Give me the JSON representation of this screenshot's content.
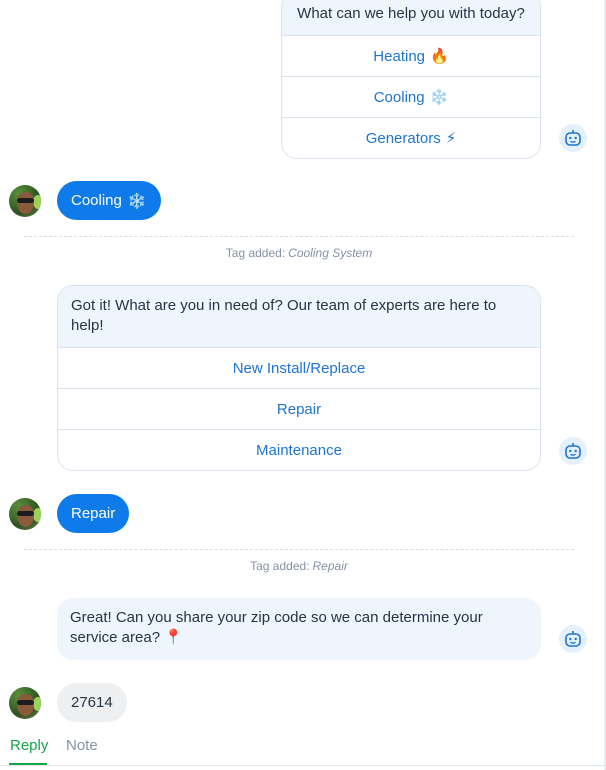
{
  "bot_messages": {
    "service_type": {
      "text": "What can we help you with today?",
      "options": [
        {
          "label": "Heating",
          "emoji": "🔥"
        },
        {
          "label": "Cooling",
          "emoji": "❄️"
        },
        {
          "label": "Generators",
          "emoji": "⚡"
        }
      ]
    },
    "need": {
      "text": "Got it! What are you in need of? Our team of experts are here to help!",
      "options": [
        {
          "label": "New Install/Replace"
        },
        {
          "label": "Repair"
        },
        {
          "label": "Maintenance"
        }
      ]
    },
    "zip": {
      "text": "Great! Can you share your zip code so we can determine your service area? 📍"
    }
  },
  "user_messages": {
    "cooling": {
      "label": "Cooling",
      "emoji": "❄️"
    },
    "repair": {
      "label": "Repair"
    },
    "zip": {
      "label": "27614"
    }
  },
  "tags": {
    "cooling": {
      "prefix": "Tag added:",
      "value": "Cooling System"
    },
    "repair": {
      "prefix": "Tag added:",
      "value": "Repair"
    }
  },
  "footer": {
    "reply_label": "Reply",
    "note_label": "Note"
  },
  "colors": {
    "accent_blue": "#0f7bea",
    "link_blue": "#1f74d1",
    "reply_green": "#16a34a",
    "bot_bubble_bg": "#eef5fc"
  },
  "icons": {
    "bot": "robot-icon",
    "user": "user-avatar"
  }
}
